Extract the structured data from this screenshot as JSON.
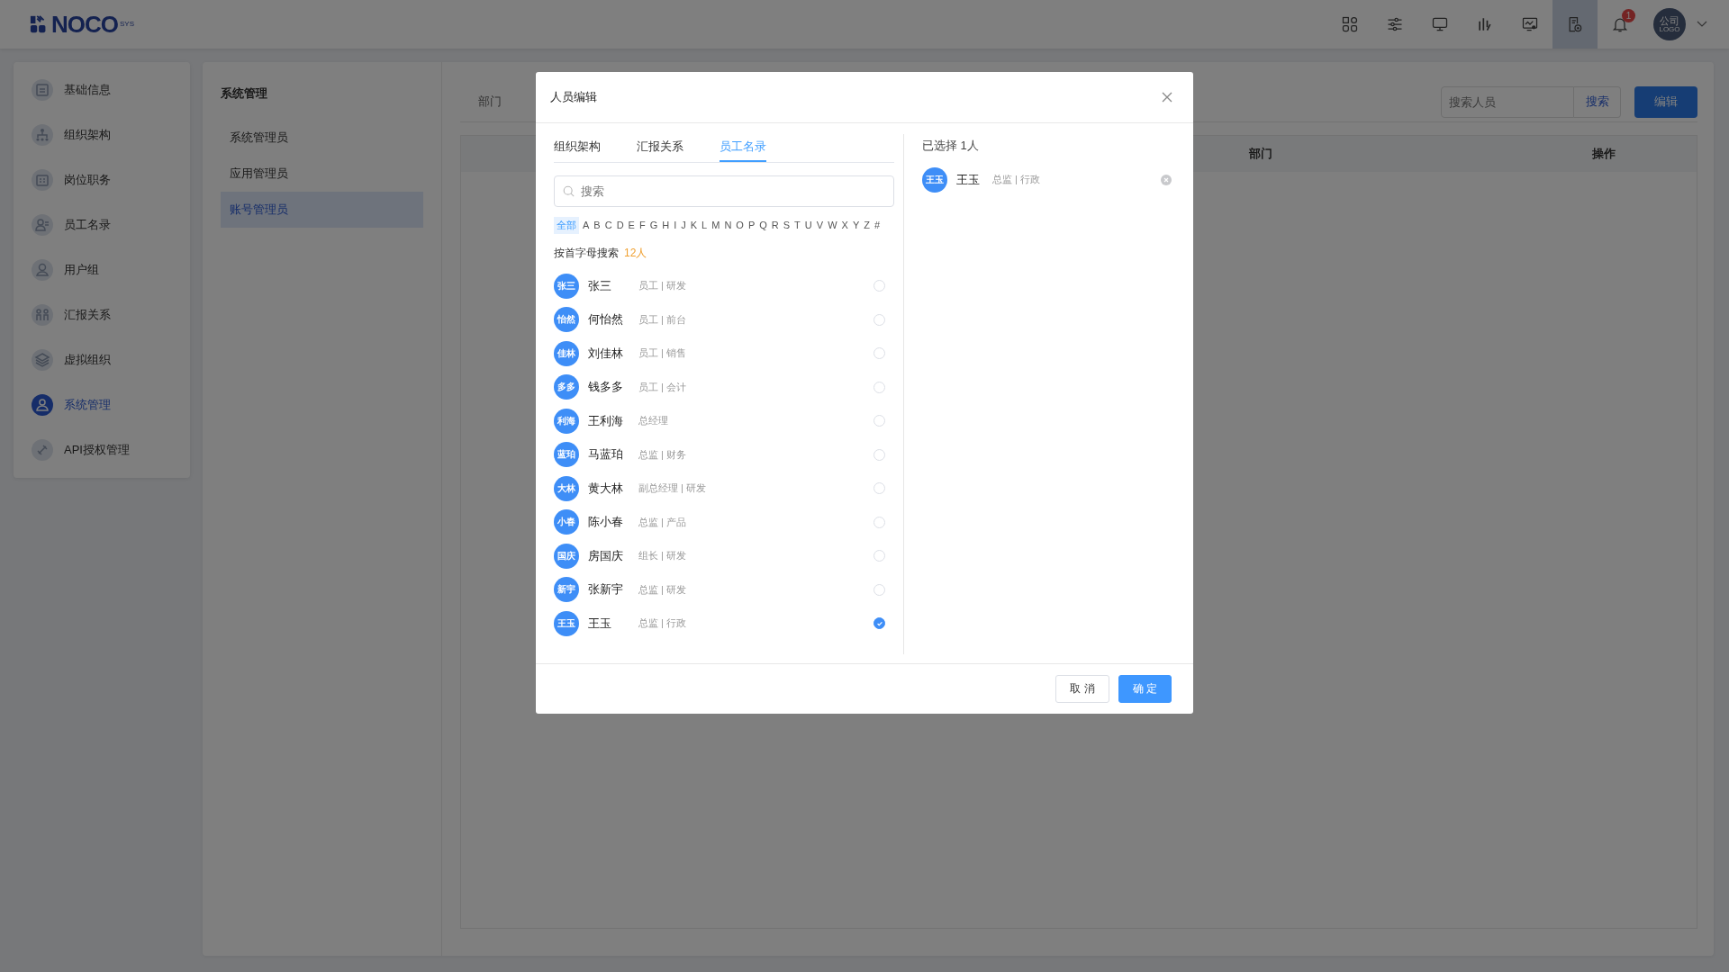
{
  "header": {
    "logo": {
      "text": "NOCO",
      "superscript": "SYS"
    },
    "tools": [
      {
        "kind": "apps",
        "selected": false
      },
      {
        "kind": "sliders",
        "selected": false
      },
      {
        "kind": "monitor",
        "selected": false
      },
      {
        "kind": "chart",
        "selected": false
      },
      {
        "kind": "screen-gear",
        "selected": false
      },
      {
        "kind": "doc-gear",
        "selected": true
      }
    ],
    "notifications": {
      "count": "1"
    },
    "avatar": {
      "line1": "公司",
      "line2": "LOGO"
    }
  },
  "sidebar": {
    "items": [
      {
        "label": "基础信息",
        "selected": false
      },
      {
        "label": "组织架构",
        "selected": false
      },
      {
        "label": "岗位职务",
        "selected": false
      },
      {
        "label": "员工名录",
        "selected": false
      },
      {
        "label": "用户组",
        "selected": false
      },
      {
        "label": "汇报关系",
        "selected": false
      },
      {
        "label": "虚拟组织",
        "selected": false
      },
      {
        "label": "系统管理",
        "selected": true
      },
      {
        "label": "API授权管理",
        "selected": false
      }
    ]
  },
  "submenu": {
    "title": "系统管理",
    "items": [
      {
        "label": "系统管理员",
        "selected": false
      },
      {
        "label": "应用管理员",
        "selected": false
      },
      {
        "label": "账号管理员",
        "selected": true
      }
    ]
  },
  "content": {
    "tabs": [
      {
        "label": "部门",
        "selected": false
      }
    ],
    "search": {
      "placeholder": "搜索人员",
      "button": "搜索"
    },
    "edit_button": "编辑",
    "table": {
      "columns": [
        "部门",
        "操作"
      ]
    }
  },
  "dialog": {
    "title": "人员编辑",
    "tabs": [
      {
        "label": "组织架构",
        "selected": false
      },
      {
        "label": "汇报关系",
        "selected": false
      },
      {
        "label": "员工名录",
        "selected": true
      }
    ],
    "search": {
      "placeholder": "搜索"
    },
    "letters": [
      {
        "label": "全部",
        "selected": true
      },
      {
        "label": "A",
        "selected": false
      },
      {
        "label": "B",
        "selected": false
      },
      {
        "label": "C",
        "selected": false
      },
      {
        "label": "D",
        "selected": false
      },
      {
        "label": "E",
        "selected": false
      },
      {
        "label": "F",
        "selected": false
      },
      {
        "label": "G",
        "selected": false
      },
      {
        "label": "H",
        "selected": false
      },
      {
        "label": "I",
        "selected": false
      },
      {
        "label": "J",
        "selected": false
      },
      {
        "label": "K",
        "selected": false
      },
      {
        "label": "L",
        "selected": false
      },
      {
        "label": "M",
        "selected": false
      },
      {
        "label": "N",
        "selected": false
      },
      {
        "label": "O",
        "selected": false
      },
      {
        "label": "P",
        "selected": false
      },
      {
        "label": "Q",
        "selected": false
      },
      {
        "label": "R",
        "selected": false
      },
      {
        "label": "S",
        "selected": false
      },
      {
        "label": "T",
        "selected": false
      },
      {
        "label": "U",
        "selected": false
      },
      {
        "label": "V",
        "selected": false
      },
      {
        "label": "W",
        "selected": false
      },
      {
        "label": "X",
        "selected": false
      },
      {
        "label": "Y",
        "selected": false
      },
      {
        "label": "Z",
        "selected": false
      },
      {
        "label": "#",
        "selected": false
      }
    ],
    "count_label": "按首字母搜索",
    "count": "12人",
    "people": [
      {
        "avatar": "张三",
        "name": "张三",
        "role": "员工 | 研发",
        "selected": false
      },
      {
        "avatar": "怡然",
        "name": "何怡然",
        "role": "员工 | 前台",
        "selected": false
      },
      {
        "avatar": "佳林",
        "name": "刘佳林",
        "role": "员工 | 销售",
        "selected": false
      },
      {
        "avatar": "多多",
        "name": "钱多多",
        "role": "员工 | 会计",
        "selected": false
      },
      {
        "avatar": "利海",
        "name": "王利海",
        "role": "总经理",
        "selected": false
      },
      {
        "avatar": "蓝珀",
        "name": "马蓝珀",
        "role": "总监 | 财务",
        "selected": false
      },
      {
        "avatar": "大林",
        "name": "黄大林",
        "role": "副总经理 | 研发",
        "selected": false
      },
      {
        "avatar": "小春",
        "name": "陈小春",
        "role": "总监 | 产品",
        "selected": false
      },
      {
        "avatar": "国庆",
        "name": "房国庆",
        "role": "组长 | 研发",
        "selected": false
      },
      {
        "avatar": "新宇",
        "name": "张新宇",
        "role": "总监 | 研发",
        "selected": false
      },
      {
        "avatar": "王玉",
        "name": "王玉",
        "role": "总监 | 行政",
        "selected": true
      }
    ],
    "selected_title": "已选择 1人",
    "selected_people": [
      {
        "avatar": "王玉",
        "name": "王玉",
        "role": "总监 | 行政"
      }
    ],
    "cancel_button": "取 消",
    "ok_button": "确 定"
  }
}
